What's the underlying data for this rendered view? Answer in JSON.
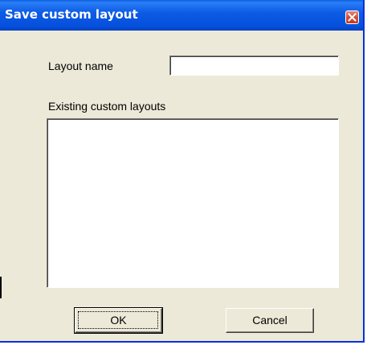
{
  "window": {
    "title": "Save custom layout",
    "close_icon": "close-icon",
    "colors": {
      "titlebar": "#0550dd",
      "face": "#ece9d8",
      "close": "#c2371d"
    }
  },
  "form": {
    "layout_name_label": "Layout name",
    "layout_name_value": "",
    "existing_label": "Existing custom layouts",
    "existing_items": []
  },
  "buttons": {
    "ok_label": "OK",
    "cancel_label": "Cancel"
  }
}
